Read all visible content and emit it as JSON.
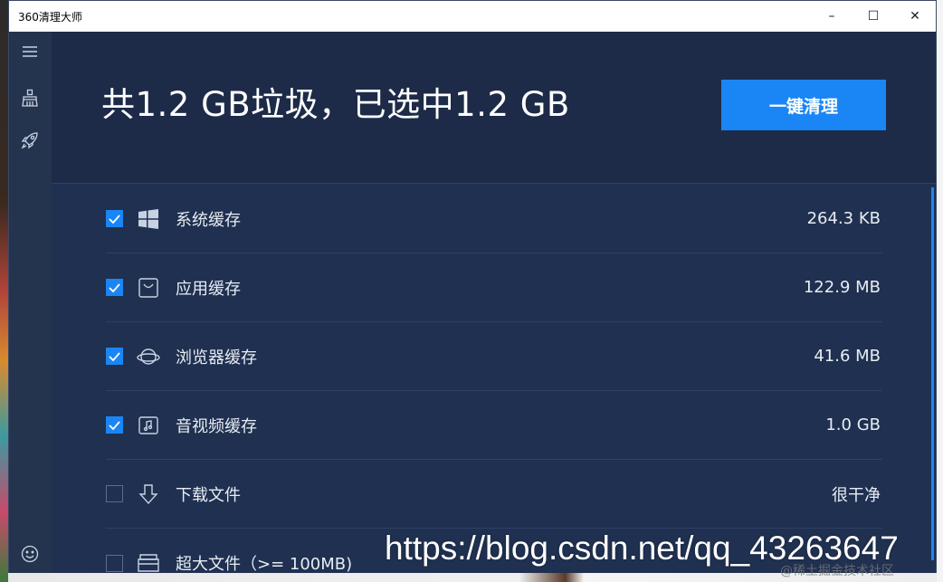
{
  "window": {
    "title": "360清理大师",
    "minimize": "–",
    "maximize": "☐",
    "close": "✕"
  },
  "summary": {
    "text": "共1.2 GB垃圾，已选中1.2 GB"
  },
  "actions": {
    "clean_label": "一键清理"
  },
  "items": [
    {
      "label": "系统缓存",
      "value": "264.3 KB",
      "checked": true,
      "icon": "windows-icon"
    },
    {
      "label": "应用缓存",
      "value": "122.9 MB",
      "checked": true,
      "icon": "shopping-bag-icon"
    },
    {
      "label": "浏览器缓存",
      "value": "41.6 MB",
      "checked": true,
      "icon": "planet-icon"
    },
    {
      "label": "音视频缓存",
      "value": "1.0 GB",
      "checked": true,
      "icon": "music-file-icon"
    },
    {
      "label": "下载文件",
      "value": "很干净",
      "checked": false,
      "icon": "download-arrow-icon"
    },
    {
      "label": "超大文件（>= 100MB)",
      "value": "",
      "checked": false,
      "icon": "tray-icon"
    }
  ],
  "sidebar": {
    "icons": [
      "menu-icon",
      "broom-icon",
      "rocket-icon",
      "smiley-icon"
    ]
  },
  "watermark": {
    "url": "https://blog.csdn.net/qq_43263647",
    "tag": "@稀土掘金技术社区"
  },
  "colors": {
    "accent": "#1a86f5",
    "window_bg": "#1f3050",
    "sidebar_bg": "#24344f"
  }
}
